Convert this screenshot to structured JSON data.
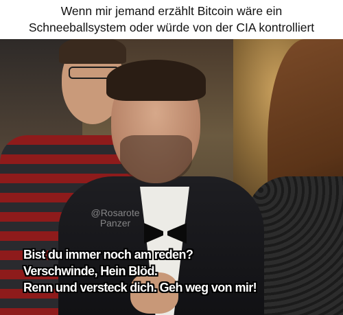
{
  "top_caption": {
    "line1": "Wenn mir jemand erzählt Bitcoin wäre ein",
    "line2": "Schneeballsystem oder würde von der CIA kontrolliert"
  },
  "watermark": {
    "line1": "@Rosarote",
    "line2": "Panzer"
  },
  "bottom_caption": {
    "line1": "Bist du immer noch am reden?",
    "line2": "Verschwinde, Hein Blöd.",
    "line3": "Renn und versteck dich. Geh weg von mir!"
  }
}
